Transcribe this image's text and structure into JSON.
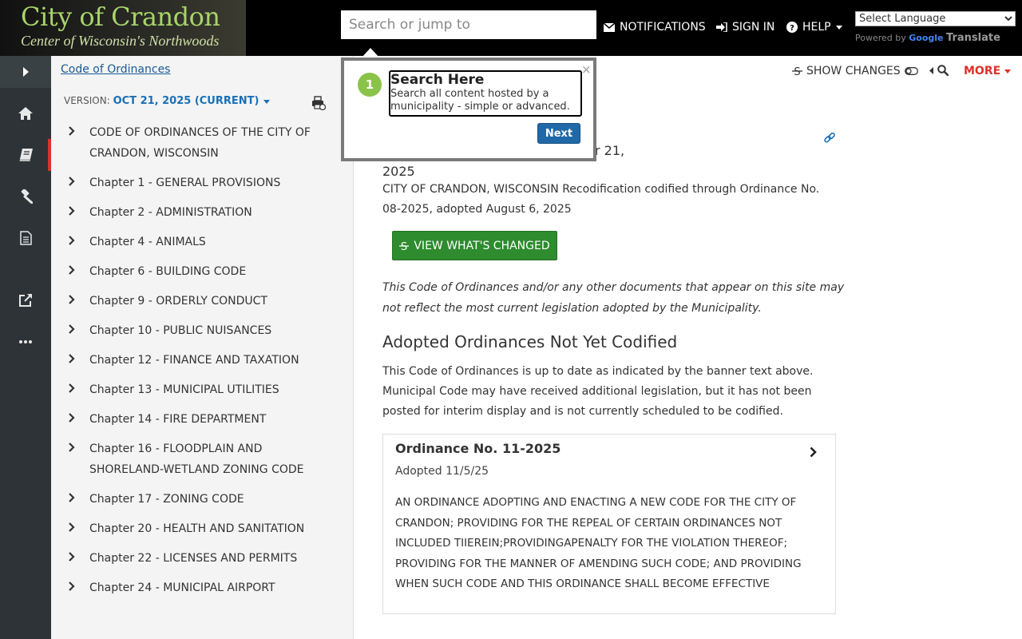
{
  "header": {
    "logo_title": "City of Crandon",
    "logo_subtitle": "Center of Wisconsin's Northwoods",
    "search_placeholder": "Search or jump to",
    "notifications_label": "NOTIFICATIONS",
    "signin_label": "SIGN IN",
    "help_label": "HELP",
    "language_selected": "Select Language",
    "powered_by": "Powered by",
    "google": "Google",
    "translate": "Translate"
  },
  "rail": {
    "icons": [
      "chevron-right-icon",
      "home-icon",
      "book-icon",
      "gavel-icon",
      "document-icon",
      "external-link-icon",
      "more-icon"
    ]
  },
  "toc": {
    "breadcrumb": "Code of Ordinances",
    "version_label": "VERSION:",
    "version_value": "OCT 21, 2025 (CURRENT)",
    "items": [
      "CODE OF ORDINANCES OF THE CITY OF CRANDON, WISCONSIN",
      "Chapter 1 - GENERAL PROVISIONS",
      "Chapter 2 - ADMINISTRATION",
      "Chapter 4 - ANIMALS",
      "Chapter 6 - BUILDING CODE",
      "Chapter 9 - ORDERLY CONDUCT",
      "Chapter 10 - PUBLIC NUISANCES",
      "Chapter 12 - FINANCE AND TAXATION",
      "Chapter 13 - MUNICIPAL UTILITIES",
      "Chapter 14 - FIRE DEPARTMENT",
      "Chapter 16 - FLOODPLAIN AND SHORELAND-WETLAND ZONING CODE",
      "Chapter 17 - ZONING CODE",
      "Chapter 20 - HEALTH AND SANITATION",
      "Chapter 22 - LICENSES AND PERMITS",
      "Chapter 24 - MUNICIPAL AIRPORT"
    ]
  },
  "main": {
    "show_changes": "SHOW CHANGES",
    "more": "MORE",
    "version_line_end": "r 21,",
    "version_year": "2025",
    "codified_text": "CITY OF CRANDON, WISCONSIN Recodification codified through Ordinance No. 08-2025, adopted August 6, 2025",
    "view_changed_label": "VIEW WHAT'S CHANGED",
    "disclaimer": "This Code of Ordinances and/or any other documents that appear on this site may not reflect the most current legislation adopted by the Municipality.",
    "section_title": "Adopted Ordinances Not Yet Codified",
    "section_text": "This Code of Ordinances is up to date as indicated by the banner text above. Municipal Code may have received additional legislation, but it has not been posted for interim display and is not currently scheduled to be codified.",
    "ordinance": {
      "title": "Ordinance No. 11-2025",
      "adopted": "Adopted 11/5/25",
      "description": "AN ORDINANCE ADOPTING AND ENACTING A NEW CODE FOR THE CITY OF CRANDON; PROVIDING FOR THE REPEAL OF CERTAIN ORDINANCES NOT INCLUDED TIIEREIN;PROVIDINGAPENALTY FOR THE VIOLATION THEREOF; PROVIDING FOR THE MANNER OF AMENDING SUCH CODE; AND PROVIDING WHEN SUCH CODE AND THIS ORDINANCE SHALL BECOME EFFECTIVE"
    }
  },
  "tour": {
    "step": "1",
    "title": "Search Here",
    "text": "Search all content hosted by a municipality - simple or advanced.",
    "close": "×",
    "next_label": "Next"
  },
  "colors": {
    "accent": "#1a6fb5",
    "green_button": "#2e8b2e",
    "more_red": "#d9342b",
    "rail_bg": "#2d3336"
  }
}
